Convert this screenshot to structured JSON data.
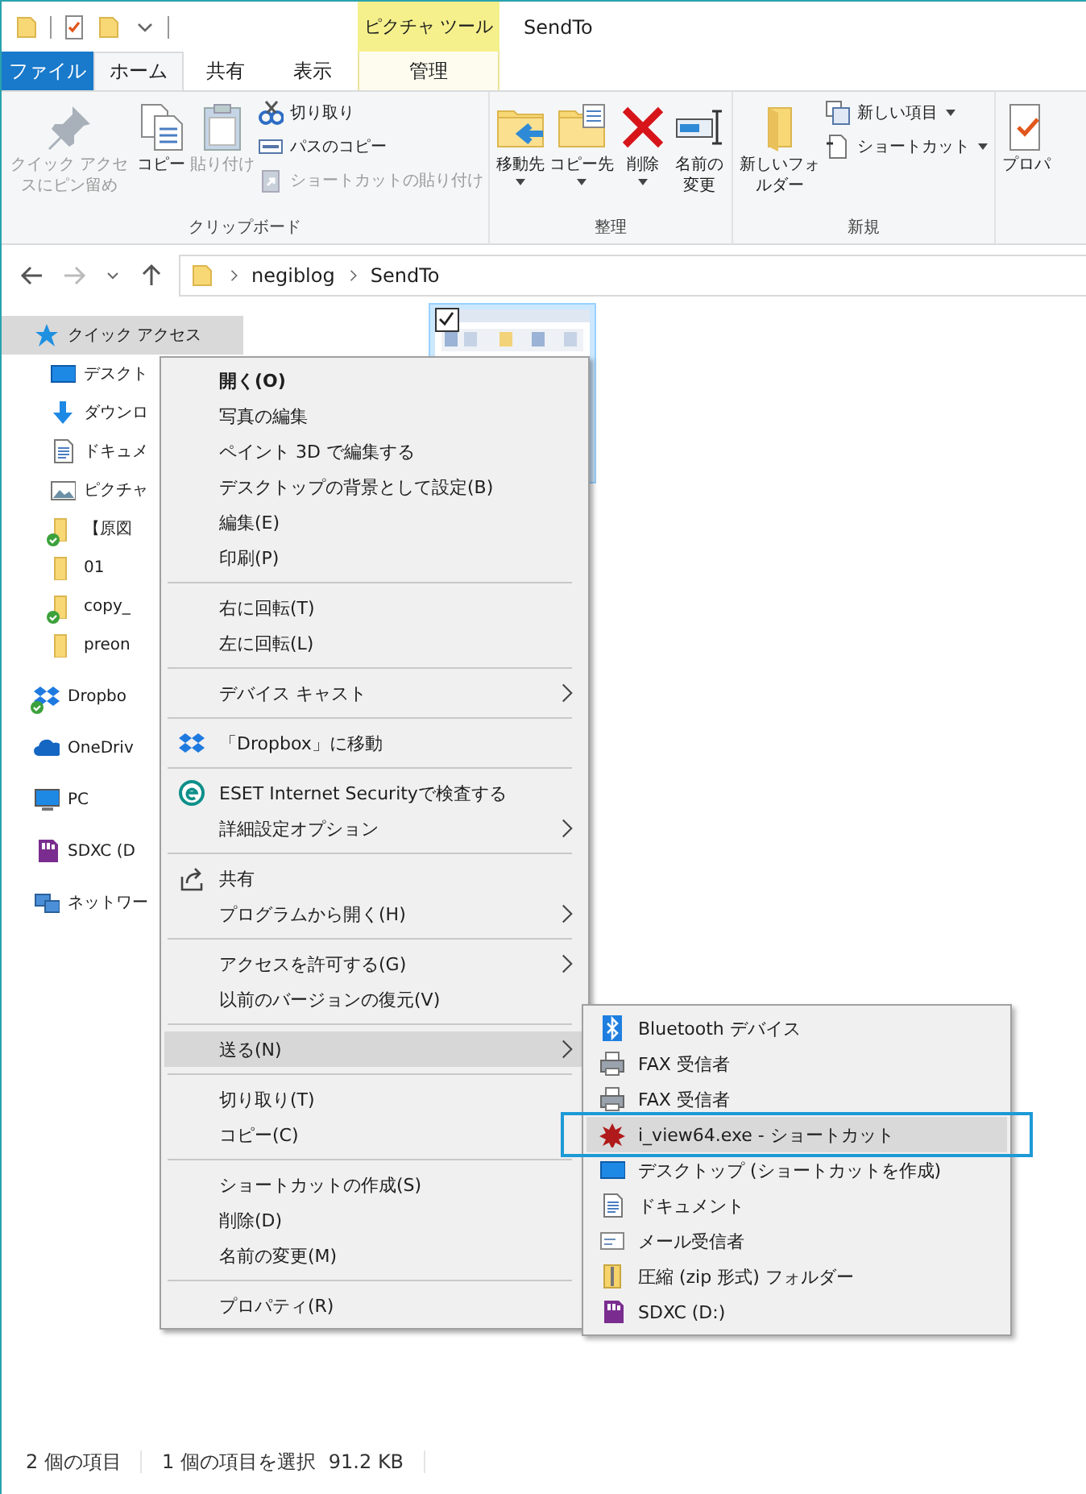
{
  "title_bar": {
    "context_tab": "ピクチャ ツール",
    "title": "SendTo"
  },
  "ribbon_tabs": [
    {
      "label": "ファイル",
      "kind": "file",
      "selected": false
    },
    {
      "label": "ホーム",
      "kind": "tab",
      "selected": true
    },
    {
      "label": "共有",
      "kind": "tab",
      "selected": false
    },
    {
      "label": "表示",
      "kind": "tab",
      "selected": false
    },
    {
      "label": "管理",
      "kind": "context",
      "selected": false
    }
  ],
  "ribbon_groups": [
    {
      "label": "クリップボード",
      "commands": [
        {
          "label": "クイック アクセスにピン留め",
          "kind": "large",
          "disabled": true,
          "dropdown": false
        },
        {
          "label": "コピー",
          "kind": "large",
          "disabled": false,
          "dropdown": false
        },
        {
          "label": "貼り付け",
          "kind": "large",
          "disabled": true,
          "dropdown": false
        },
        {
          "label": "切り取り",
          "kind": "small",
          "disabled": false,
          "dropdown": false
        },
        {
          "label": "パスのコピー",
          "kind": "small",
          "disabled": false,
          "dropdown": false
        },
        {
          "label": "ショートカットの貼り付け",
          "kind": "small",
          "disabled": true,
          "dropdown": false
        }
      ]
    },
    {
      "label": "整理",
      "commands": [
        {
          "label": "移動先",
          "kind": "large",
          "disabled": false,
          "dropdown": true
        },
        {
          "label": "コピー先",
          "kind": "large",
          "disabled": false,
          "dropdown": true
        },
        {
          "label": "削除",
          "kind": "large",
          "disabled": false,
          "dropdown": true
        },
        {
          "label": "名前の変更",
          "kind": "large",
          "disabled": false,
          "dropdown": false
        }
      ]
    },
    {
      "label": "新規",
      "commands": [
        {
          "label": "新しいフォルダー",
          "kind": "large",
          "disabled": false,
          "dropdown": false
        },
        {
          "label": "新しい項目",
          "kind": "small",
          "disabled": false,
          "dropdown": true
        },
        {
          "label": "ショートカット",
          "kind": "small",
          "disabled": false,
          "dropdown": true
        }
      ]
    },
    {
      "commands": [
        {
          "label": "プロパ",
          "kind": "large",
          "disabled": false,
          "dropdown": false
        }
      ]
    }
  ],
  "address_bar": {
    "back_disabled": false,
    "forward_disabled": true,
    "path": [
      "negiblog",
      "SendTo"
    ]
  },
  "navigation_pane": [
    {
      "label": "クイック アクセス",
      "selected": true,
      "synced": false,
      "children": [
        {
          "label": "デスクト",
          "selected": false,
          "synced": false
        },
        {
          "label": "ダウンロ",
          "selected": false,
          "synced": false
        },
        {
          "label": "ドキュメ",
          "selected": false,
          "synced": false
        },
        {
          "label": "ピクチャ",
          "selected": false,
          "synced": false
        },
        {
          "label": "【原図",
          "selected": false,
          "synced": true
        },
        {
          "label": "01",
          "selected": false,
          "synced": false
        },
        {
          "label": "copy_",
          "selected": false,
          "synced": true
        },
        {
          "label": "preon",
          "selected": false,
          "synced": false
        }
      ]
    },
    {
      "label": "Dropbo",
      "selected": false,
      "synced": true
    },
    {
      "label": "OneDriv",
      "selected": false,
      "synced": false
    },
    {
      "label": "PC",
      "selected": false,
      "synced": false
    },
    {
      "label": "SDXC (D",
      "selected": false,
      "synced": false
    },
    {
      "label": "ネットワー",
      "selected": false,
      "synced": false
    }
  ],
  "files": [
    {
      "selected": true
    }
  ],
  "context_menu": [
    [
      {
        "label": "開く(O)",
        "default": true,
        "submenu": false,
        "highlighted": false
      },
      {
        "label": "写真の編集",
        "default": false,
        "submenu": false,
        "highlighted": false
      },
      {
        "label": "ペイント 3D で編集する",
        "default": false,
        "submenu": false,
        "highlighted": false
      },
      {
        "label": "デスクトップの背景として設定(B)",
        "default": false,
        "submenu": false,
        "highlighted": false
      },
      {
        "label": "編集(E)",
        "default": false,
        "submenu": false,
        "highlighted": false
      },
      {
        "label": "印刷(P)",
        "default": false,
        "submenu": false,
        "highlighted": false
      }
    ],
    [
      {
        "label": "右に回転(T)",
        "default": false,
        "submenu": false,
        "highlighted": false
      },
      {
        "label": "左に回転(L)",
        "default": false,
        "submenu": false,
        "highlighted": false
      }
    ],
    [
      {
        "label": "デバイス キャスト",
        "default": false,
        "submenu": true,
        "highlighted": false
      }
    ],
    [
      {
        "label": "「Dropbox」に移動",
        "default": false,
        "submenu": false,
        "highlighted": false
      }
    ],
    [
      {
        "label": "ESET Internet Securityで検査する",
        "default": false,
        "submenu": false,
        "highlighted": false
      },
      {
        "label": "詳細設定オプション",
        "default": false,
        "submenu": true,
        "highlighted": false
      }
    ],
    [
      {
        "label": "共有",
        "default": false,
        "submenu": false,
        "highlighted": false
      },
      {
        "label": "プログラムから開く(H)",
        "default": false,
        "submenu": true,
        "highlighted": false
      }
    ],
    [
      {
        "label": "アクセスを許可する(G)",
        "default": false,
        "submenu": true,
        "highlighted": false
      },
      {
        "label": "以前のバージョンの復元(V)",
        "default": false,
        "submenu": false,
        "highlighted": false
      }
    ],
    [
      {
        "label": "送る(N)",
        "default": false,
        "submenu": true,
        "highlighted": true
      }
    ],
    [
      {
        "label": "切り取り(T)",
        "default": false,
        "submenu": false,
        "highlighted": false
      },
      {
        "label": "コピー(C)",
        "default": false,
        "submenu": false,
        "highlighted": false
      }
    ],
    [
      {
        "label": "ショートカットの作成(S)",
        "default": false,
        "submenu": false,
        "highlighted": false
      },
      {
        "label": "削除(D)",
        "default": false,
        "submenu": false,
        "highlighted": false
      },
      {
        "label": "名前の変更(M)",
        "default": false,
        "submenu": false,
        "highlighted": false
      }
    ],
    [
      {
        "label": "プロパティ(R)",
        "default": false,
        "submenu": false,
        "highlighted": false
      }
    ]
  ],
  "send_to_menu": [
    {
      "label": "Bluetooth デバイス",
      "highlighted": false
    },
    {
      "label": "FAX 受信者",
      "highlighted": false
    },
    {
      "label": "FAX 受信者",
      "highlighted": false
    },
    {
      "label": "i_view64.exe - ショートカット",
      "highlighted": true
    },
    {
      "label": "デスクトップ (ショートカットを作成)",
      "highlighted": false
    },
    {
      "label": "ドキュメント",
      "highlighted": false
    },
    {
      "label": "メール受信者",
      "highlighted": false
    },
    {
      "label": "圧縮 (zip 形式) フォルダー",
      "highlighted": false
    },
    {
      "label": "SDXC (D:)",
      "highlighted": false
    }
  ],
  "status_bar": {
    "item_count": "2 個の項目",
    "selection": "1 個の項目を選択",
    "size": "91.2 KB"
  }
}
